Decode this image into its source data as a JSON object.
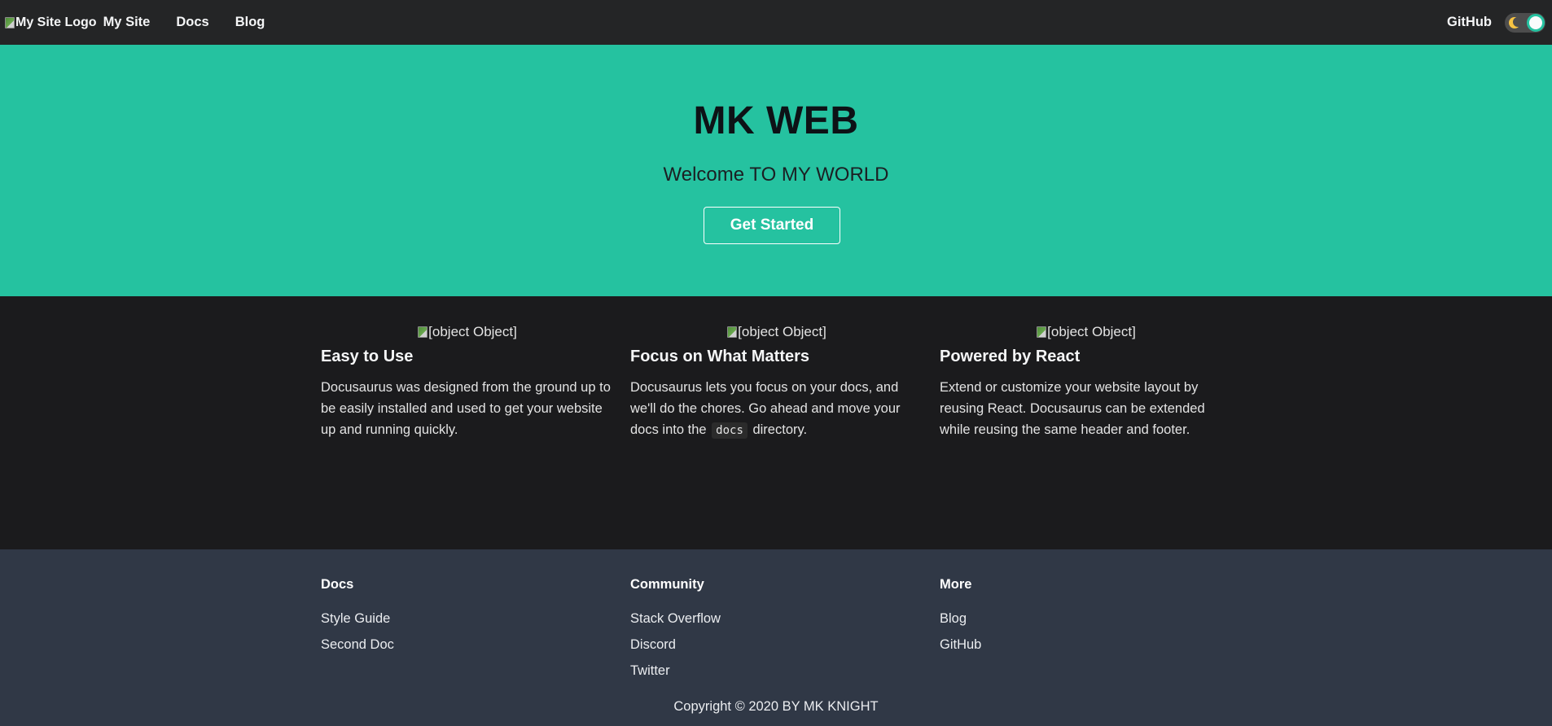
{
  "navbar": {
    "logo_alt": "My Site Logo",
    "title": "My Site",
    "links": [
      {
        "label": "Docs"
      },
      {
        "label": "Blog"
      }
    ],
    "github_label": "GitHub",
    "theme_toggle": "dark"
  },
  "hero": {
    "title": "MK WEB",
    "subtitle": "Welcome TO MY WORLD",
    "cta_label": "Get Started"
  },
  "features": [
    {
      "img_alt": "[object Object]",
      "title": "Easy to Use",
      "desc": "Docusaurus was designed from the ground up to be easily installed and used to get your website up and running quickly."
    },
    {
      "img_alt": "[object Object]",
      "title": "Focus on What Matters",
      "desc_before": "Docusaurus lets you focus on your docs, and we'll do the chores. Go ahead and move your docs into the",
      "desc_code": "docs",
      "desc_after": "directory."
    },
    {
      "img_alt": "[object Object]",
      "title": "Powered by React",
      "desc": "Extend or customize your website layout by reusing React. Docusaurus can be extended while reusing the same header and footer."
    }
  ],
  "footer": {
    "columns": [
      {
        "title": "Docs",
        "links": [
          "Style Guide",
          "Second Doc"
        ]
      },
      {
        "title": "Community",
        "links": [
          "Stack Overflow",
          "Discord",
          "Twitter"
        ]
      },
      {
        "title": "More",
        "links": [
          "Blog",
          "GitHub"
        ]
      }
    ],
    "copyright": "Copyright © 2020 BY MK KNIGHT"
  },
  "colors": {
    "navbar_bg": "#242526",
    "hero_bg": "#25c2a0",
    "features_bg": "#1b1b1d",
    "footer_bg": "#303846"
  }
}
